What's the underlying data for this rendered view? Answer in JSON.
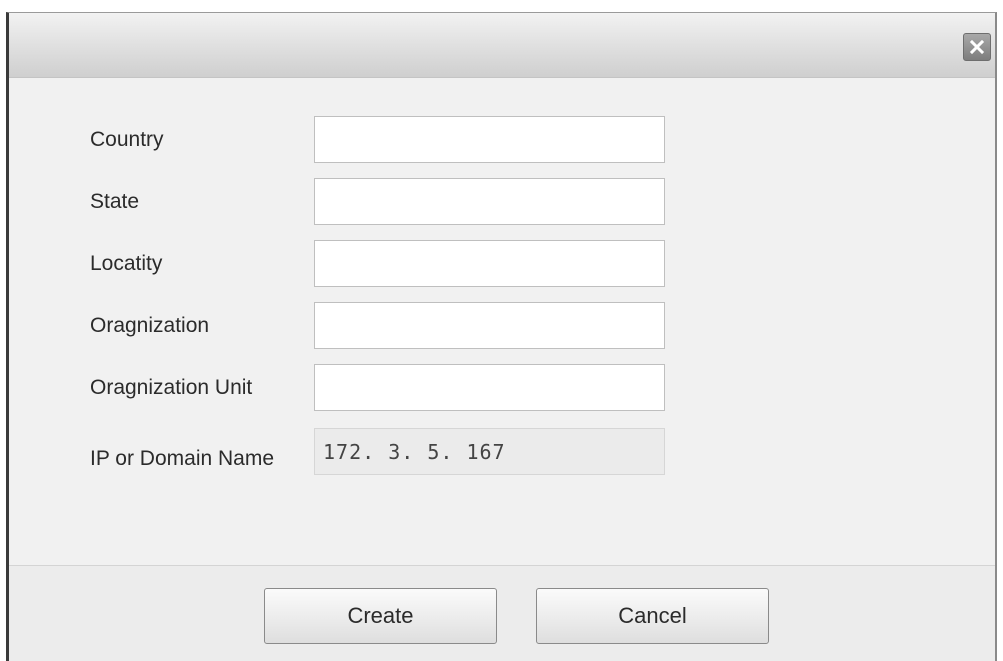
{
  "dialog": {
    "close_icon": "close-icon",
    "fields": [
      {
        "label": "Country",
        "value": ""
      },
      {
        "label": "State",
        "value": ""
      },
      {
        "label": "Locatity",
        "value": ""
      },
      {
        "label": "Oragnization",
        "value": ""
      },
      {
        "label": "Oragnization Unit",
        "value": ""
      }
    ],
    "ip_field": {
      "label": "IP or Domain Name",
      "value": "172. 3. 5. 167"
    },
    "buttons": {
      "create_label": "Create",
      "cancel_label": "Cancel"
    }
  }
}
